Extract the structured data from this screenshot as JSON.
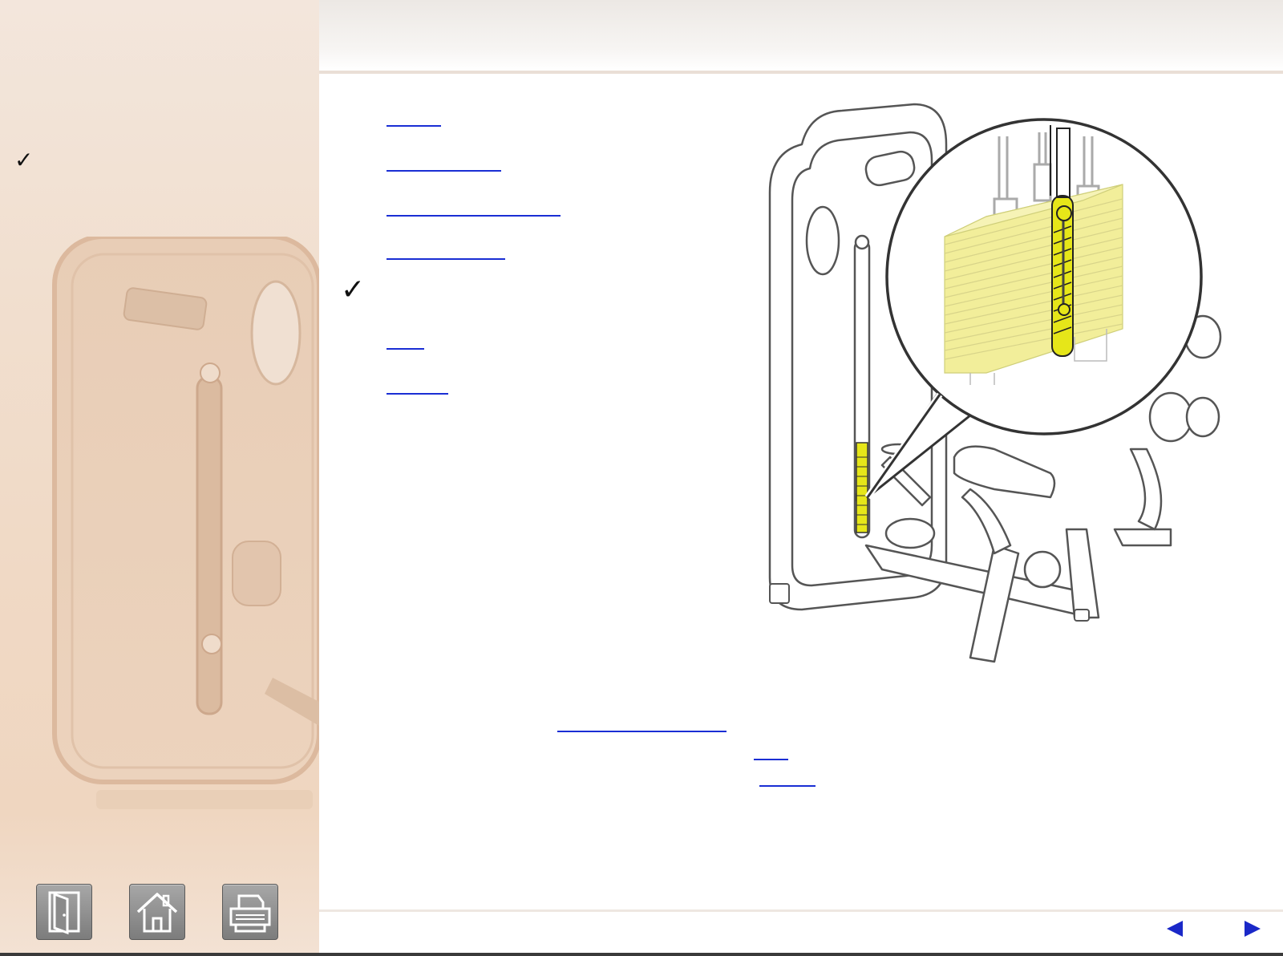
{
  "sidebar": {
    "check_mark": "✓",
    "buttons": [
      {
        "name": "exit",
        "icon": "door-exit-icon"
      },
      {
        "name": "home",
        "icon": "home-icon"
      },
      {
        "name": "print",
        "icon": "printer-icon"
      }
    ]
  },
  "main": {
    "check_mark": "✓",
    "links": [
      {
        "label": ""
      },
      {
        "label": ""
      },
      {
        "label": ""
      },
      {
        "label": ""
      },
      {
        "label": ""
      },
      {
        "label": ""
      }
    ],
    "inline_links": [
      {
        "label": ""
      },
      {
        "label": ""
      },
      {
        "label": ""
      }
    ]
  },
  "illustration": {
    "highlight_color": "#e6e619",
    "weight_stack_color": "#f2ee9a",
    "outline_color": "#555555"
  },
  "colors": {
    "link": "#1a2ed4",
    "sidebar_bg": "#f1dfcf",
    "nav_arrow": "#1a28c8",
    "button": "#8c8c8c"
  },
  "navigation": {
    "prev_icon": "triangle-left-icon",
    "next_icon": "triangle-right-icon"
  }
}
